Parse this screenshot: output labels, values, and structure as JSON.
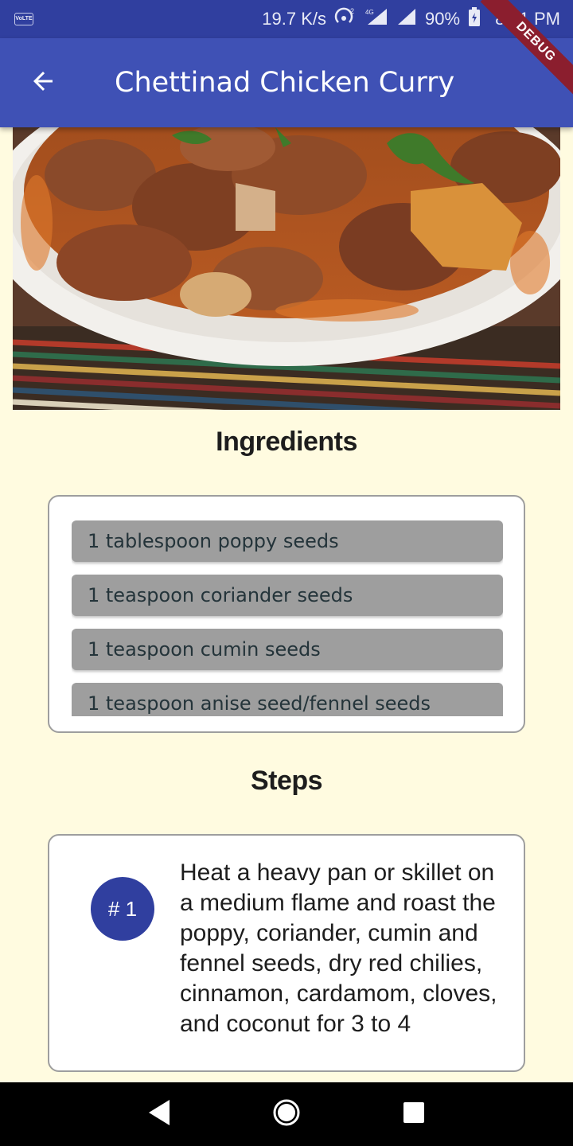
{
  "status_bar": {
    "carrier_badge": "VoLTE",
    "net_speed": "19.7 K/s",
    "battery": "90%",
    "time": "8:21 PM"
  },
  "app_bar": {
    "title": "Chettinad Chicken Curry",
    "debug_banner": "DEBUG"
  },
  "ingredients": {
    "heading": "Ingredients",
    "items": [
      "1 tablespoon poppy seeds",
      "1 teaspoon coriander seeds",
      "1 teaspoon cumin seeds",
      "1 teaspoon anise seed/fennel seeds"
    ]
  },
  "steps": {
    "heading": "Steps",
    "items": [
      {
        "badge": "# 1",
        "text": "Heat a heavy pan or skillet on a medium flame and roast the poppy, coriander, cumin and fennel seeds, dry red chilies, cinnamon, cardamom, cloves, and coconut for 3 to 4"
      }
    ]
  },
  "colors": {
    "app_bar": "#3f51b5",
    "status_bar": "#303f9f",
    "page_bg": "#fffbe0",
    "ingredient_chip": "#9e9e9e",
    "step_badge": "#303f9f",
    "debug_banner": "#8b1e2e"
  },
  "icons": {
    "back": "arrow-left-icon",
    "nav_back": "triangle-back-icon",
    "nav_home": "circle-home-icon",
    "nav_recents": "square-recents-icon"
  }
}
